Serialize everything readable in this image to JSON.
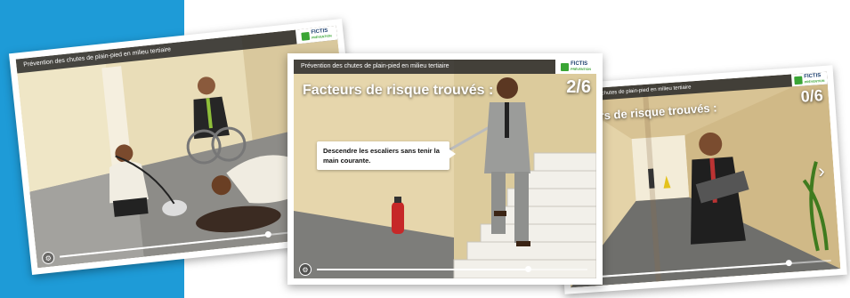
{
  "slides": [
    {
      "title": "Prévention des chutes de plain-pied en milieu tertiaire",
      "logo": {
        "text": "FICTIS",
        "subtext": "PRÉVENTION"
      },
      "progress": 0.72
    },
    {
      "title": "Prévention des chutes de plain-pied en milieu tertiaire",
      "logo": {
        "text": "FICTIS",
        "subtext": "PRÉVENTION"
      },
      "heading": "Facteurs de risque trouvés :",
      "counter": "2/6",
      "bubble": "Descendre les escaliers sans tenir la main courante.",
      "progress": 0.78
    },
    {
      "title": "Prévention des chutes de plain-pied en milieu tertiaire",
      "logo": {
        "text": "FICTIS",
        "subtext": "PRÉVENTION"
      },
      "heading": "Facteurs de risque trouvés :",
      "counter": "0/6",
      "progress": 0.82,
      "next_glyph": "›"
    }
  ],
  "colors": {
    "band": "#1e9bd7",
    "logo_green": "#3aa535",
    "logo_navy": "#1c3f6e"
  }
}
